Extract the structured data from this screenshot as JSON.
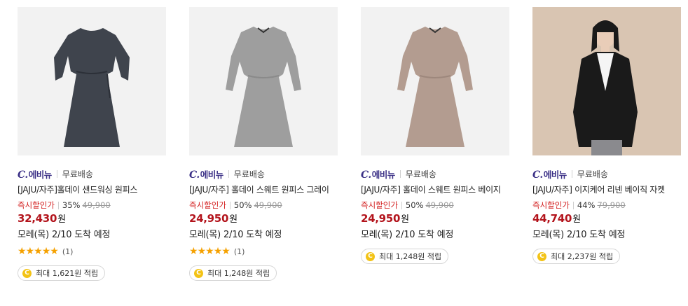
{
  "products": [
    {
      "brand_mark": "C.",
      "brand": "에비뉴",
      "shipping": "무료배송",
      "title": "[JAJU/자주]홀데이 샌드워싱 원피스",
      "discount_label": "즉시할인가",
      "discount_rate": "35%",
      "original_price": "49,900",
      "price": "32,430",
      "currency": "원",
      "delivery": "모레(목) 2/10 도착 예정",
      "rating_stars": 5,
      "review_count": "(1)",
      "coin_icon": "C",
      "reward": "최대 1,621원 적립",
      "image_color": "#3f444d"
    },
    {
      "brand_mark": "C.",
      "brand": "에비뉴",
      "shipping": "무료배송",
      "title": "[JAJU/자주] 홀데이 스웨트 원피스 그레이",
      "discount_label": "즉시할인가",
      "discount_rate": "50%",
      "original_price": "49,900",
      "price": "24,950",
      "currency": "원",
      "delivery": "모레(목) 2/10 도착 예정",
      "rating_stars": 5,
      "review_count": "(1)",
      "coin_icon": "C",
      "reward": "최대 1,248원 적립",
      "image_color": "#9e9e9e"
    },
    {
      "brand_mark": "C.",
      "brand": "에비뉴",
      "shipping": "무료배송",
      "title": "[JAJU/자주] 홀데이 스웨트 원피스 베이지",
      "discount_label": "즉시할인가",
      "discount_rate": "50%",
      "original_price": "49,900",
      "price": "24,950",
      "currency": "원",
      "delivery": "모레(목) 2/10 도착 예정",
      "coin_icon": "C",
      "reward": "최대 1,248원 적립",
      "image_color": "#b39c90"
    },
    {
      "brand_mark": "C.",
      "brand": "에비뉴",
      "shipping": "무료배송",
      "title": "[JAJU/자주] 이지케어 리넨 베이직 자켓",
      "discount_label": "즉시할인가",
      "discount_rate": "44%",
      "original_price": "79,900",
      "price": "44,740",
      "currency": "원",
      "delivery": "모레(목) 2/10 도착 예정",
      "coin_icon": "C",
      "reward": "최대 2,237원 적립",
      "image_color": "#1a1a1a"
    }
  ],
  "icons": {
    "star": "star-icon",
    "coin": "coin-icon"
  },
  "star_glyph": "★"
}
